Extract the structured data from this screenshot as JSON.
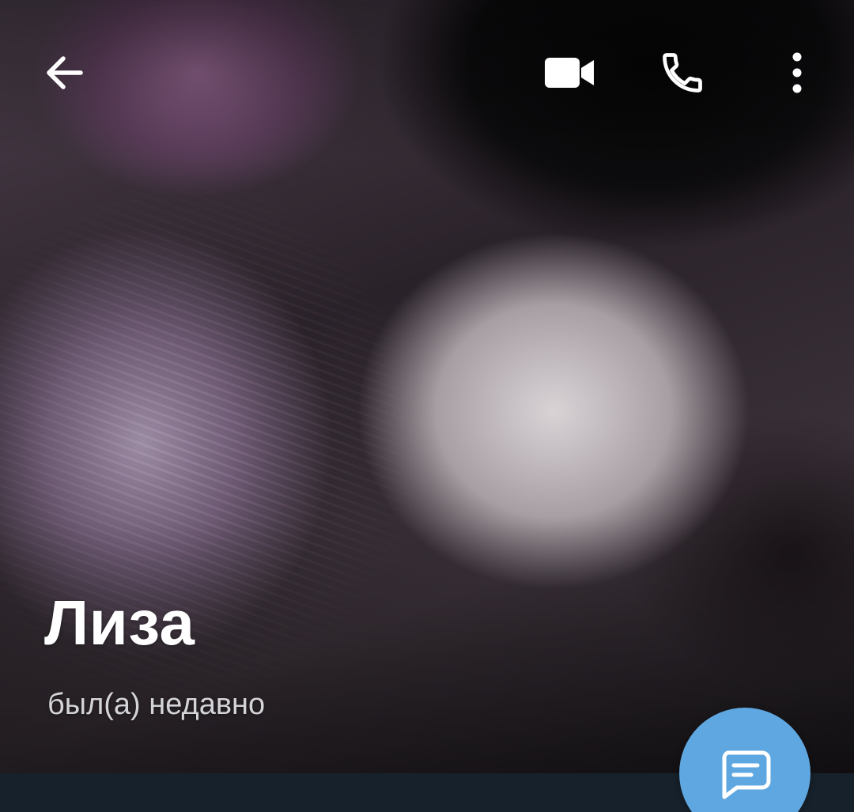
{
  "profile": {
    "name": "Лиза",
    "status": "был(а) недавно"
  },
  "toolbar": {
    "icons": [
      "arrow-left-icon",
      "video-camera-icon",
      "phone-icon",
      "more-vertical-icon"
    ]
  },
  "fab": {
    "icon": "chat-bubble-icon"
  },
  "colors": {
    "fab_background": "#5fa7e0",
    "bottom_bar": "#17212b",
    "name_text": "#ffffff",
    "status_text": "#d4d4d8"
  }
}
